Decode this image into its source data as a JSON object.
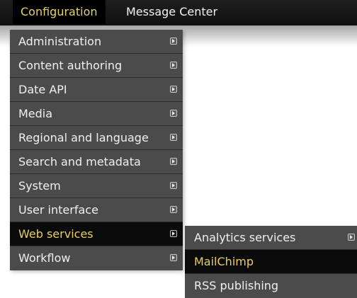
{
  "top_nav": {
    "items": [
      {
        "label": "Configuration",
        "active": true
      },
      {
        "label": "Message Center",
        "active": false
      }
    ]
  },
  "menu": {
    "items": [
      {
        "label": "Administration",
        "has_submenu": true
      },
      {
        "label": "Content authoring",
        "has_submenu": true
      },
      {
        "label": "Date API",
        "has_submenu": true
      },
      {
        "label": "Media",
        "has_submenu": true
      },
      {
        "label": "Regional and language",
        "has_submenu": true
      },
      {
        "label": "Search and metadata",
        "has_submenu": true
      },
      {
        "label": "System",
        "has_submenu": true
      },
      {
        "label": "User interface",
        "has_submenu": true
      },
      {
        "label": "Web services",
        "has_submenu": true,
        "highlighted": true
      },
      {
        "label": "Workflow",
        "has_submenu": true
      }
    ]
  },
  "submenu": {
    "items": [
      {
        "label": "Analytics services",
        "has_submenu": true
      },
      {
        "label": "MailChimp",
        "highlighted": true
      },
      {
        "label": "RSS publishing"
      }
    ]
  },
  "colors": {
    "topbar_bg": "#1a1a1a",
    "menu_bg": "#4b4b4b",
    "highlight_bg": "#0a0a0a",
    "highlight_text": "#e8cf60",
    "text": "#f0f0f0"
  },
  "icons": {
    "submenu_arrow": "submenu-arrow-icon"
  }
}
